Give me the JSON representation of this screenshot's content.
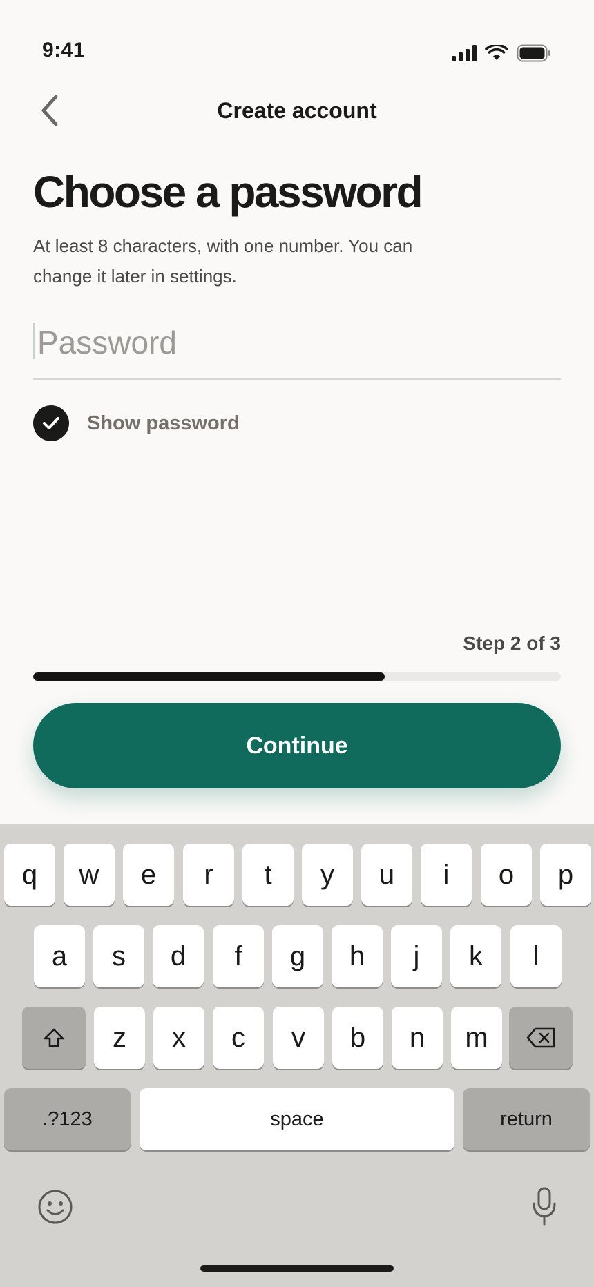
{
  "status_bar": {
    "time": "9:41"
  },
  "nav": {
    "title": "Create account"
  },
  "form": {
    "heading": "Choose a password",
    "subtitle": "At least 8 characters, with one number. You can change it later in settings.",
    "password_placeholder": "Password",
    "password_value": "",
    "show_password_label": "Show password",
    "show_password_checked": true
  },
  "progress": {
    "step_label": "Step 2 of 3",
    "fraction": 0.6667
  },
  "continue_label": "Continue",
  "keyboard": {
    "rows": [
      [
        "q",
        "w",
        "e",
        "r",
        "t",
        "y",
        "u",
        "i",
        "o",
        "p"
      ],
      [
        "a",
        "s",
        "d",
        "f",
        "g",
        "h",
        "j",
        "k",
        "l"
      ],
      [
        "z",
        "x",
        "c",
        "v",
        "b",
        "n",
        "m"
      ]
    ],
    "numbers_label": ".?123",
    "space_label": "space",
    "return_label": "return"
  },
  "colors": {
    "accent": "#106b5c",
    "background": "#faf9f7",
    "progress_fill": "#141412"
  }
}
